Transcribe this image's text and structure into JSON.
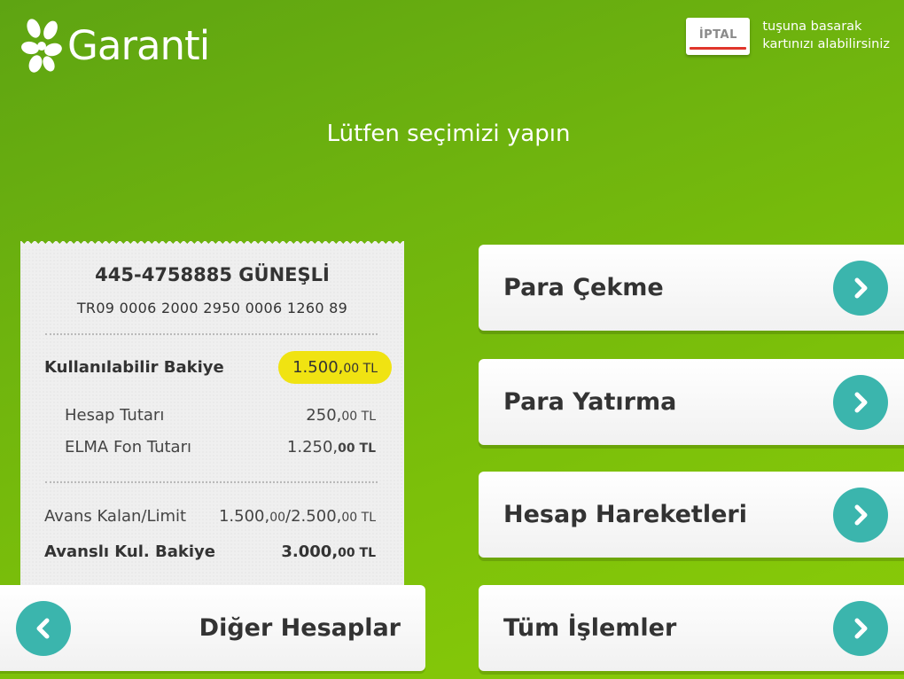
{
  "brand": {
    "name": "Garanti"
  },
  "cancel": {
    "button_label": "İPTAL",
    "hint_line1": "tuşuna basarak",
    "hint_line2": "kartınızı alabilirsiniz"
  },
  "prompt": "Lütfen seçimizi yapın",
  "account": {
    "title": "445-4758885 GÜNEŞLİ",
    "iban": "TR09 0006 2000 2950 0006 1260 89",
    "available_label": "Kullanılabilir Bakiye",
    "available_int": "1.500,",
    "available_dec": "00 TL",
    "account_amount_label": "Hesap Tutarı",
    "account_amount_int": "250,",
    "account_amount_dec": "00 TL",
    "fund_label": "ELMA Fon Tutarı",
    "fund_int": "1.250,",
    "fund_dec": "00 TL",
    "advance_label": "Avans Kalan/Limit",
    "advance_int1": "1.500,",
    "advance_dec1": "00",
    "advance_sep": "/",
    "advance_int2": "2.500,",
    "advance_dec2": "00 TL",
    "adv_balance_label": "Avanslı Kul. Bakiye",
    "adv_balance_int": "3.000,",
    "adv_balance_dec": "00 TL"
  },
  "other_accounts": {
    "label": "Diğer Hesaplar"
  },
  "menu": [
    {
      "label": "Para Çekme"
    },
    {
      "label": "Para Yatırma"
    },
    {
      "label": "Hesap Hareketleri"
    },
    {
      "label": "Tüm İşlemler"
    }
  ],
  "colors": {
    "accent_teal": "#3bb5ad",
    "highlight_yellow": "#f0e312",
    "cancel_red": "#e0352b",
    "background_green": "#6fb40e"
  }
}
